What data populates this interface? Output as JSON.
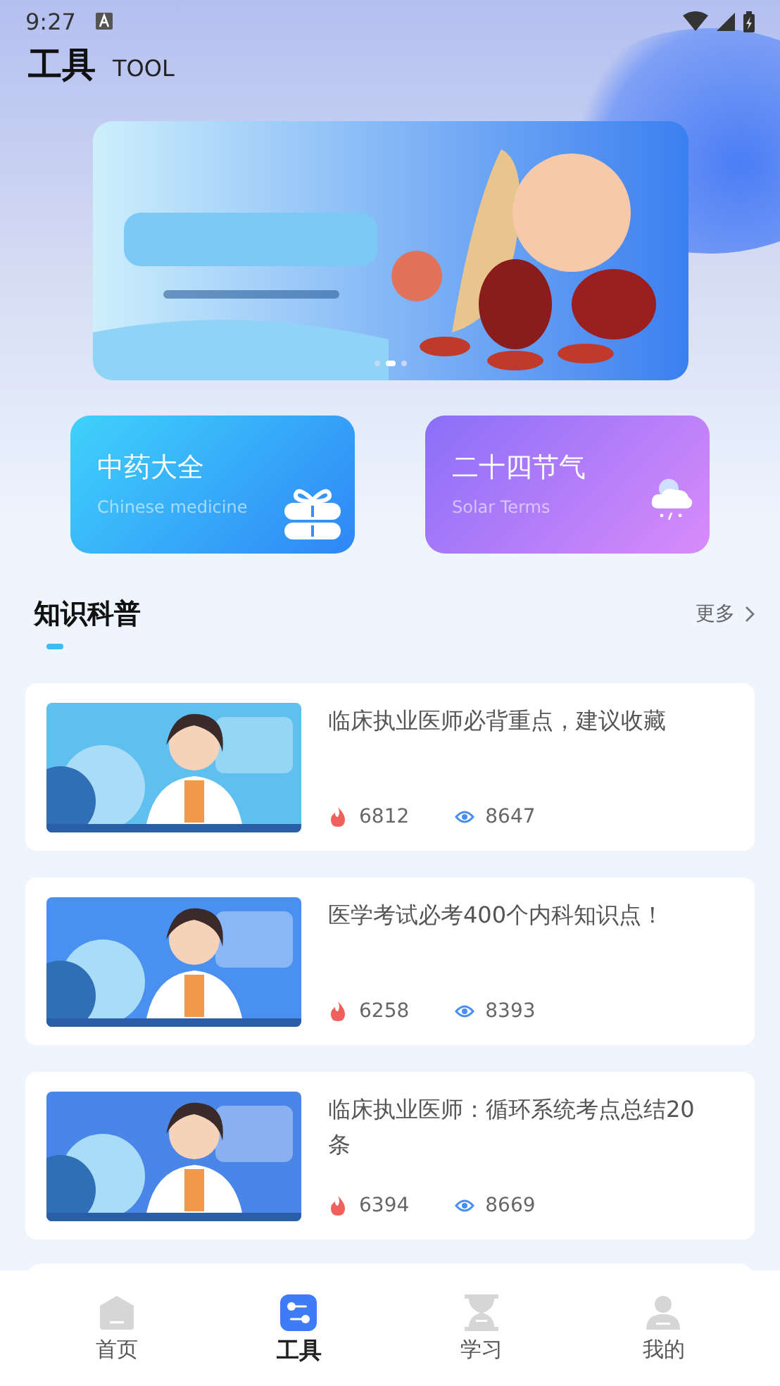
{
  "status_bar": {
    "time": "9:27"
  },
  "header": {
    "title": "工具",
    "subtitle": "TOOL"
  },
  "banner": {
    "kind": "picture",
    "dots": [
      {
        "selected": false
      },
      {
        "selected": true
      },
      {
        "selected": false
      }
    ]
  },
  "tiles": [
    {
      "title": "中药大全",
      "subtitle": "Chinese medicine",
      "kind": "gift"
    },
    {
      "title": "二十四节气",
      "subtitle": "Solar Terms",
      "kind": "weather"
    }
  ],
  "section": {
    "title": "知识科普",
    "more": "更多"
  },
  "articles": [
    {
      "title": "临床执业医师必背重点，建议收藏",
      "likes": "6812",
      "views": "8647"
    },
    {
      "title": "医学考试必考400个内科知识点！",
      "likes": "6258",
      "views": "8393"
    },
    {
      "title": "临床执业医师：循环系统考点总结20条",
      "likes": "6394",
      "views": "8669"
    }
  ],
  "nav": [
    {
      "label": "首页",
      "kind": "home",
      "selected": false
    },
    {
      "label": "工具",
      "kind": "tools",
      "selected": true
    },
    {
      "label": "学习",
      "kind": "hourglass",
      "selected": false
    },
    {
      "label": "我的",
      "kind": "person",
      "selected": false
    }
  ]
}
